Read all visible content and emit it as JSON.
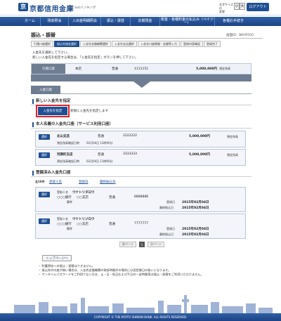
{
  "header": {
    "logo_mark": "京",
    "bank_name": "京都信用金庫",
    "service_name": "京信 hotバンキング",
    "font_size_label": "文字サイズの\n変更",
    "font_small": "小",
    "font_large": "大",
    "logout_label": "ログアウト"
  },
  "gnav": [
    "ホーム",
    "残高照会",
    "入出金明細照会",
    "振込・振替",
    "定期預金",
    "税金・各種料金の払込み（ペイジー）",
    "各種お手続き"
  ],
  "page": {
    "title": "振込・振替",
    "screen_id": "画面ID：BKHF050"
  },
  "steps": [
    {
      "label": "引落口座選択",
      "active": false
    },
    {
      "label": "振込先指定選択",
      "active": true
    },
    {
      "label": "入金先金融機関選択",
      "active": false
    },
    {
      "label": "入金先支店選択",
      "active": false
    },
    {
      "label": "入金先口座情報・金額等入力",
      "active": false
    },
    {
      "label": "登録内容確認",
      "active": false
    },
    {
      "label": "登録完了",
      "active": false
    }
  ],
  "instructions": [
    "入金先を選択して下さい。",
    "新しい入金先を指定する場合は、「入金先を指定」ボタンを押して下さい。"
  ],
  "withdrawal": {
    "label": "引落口座",
    "branch": "本店",
    "type": "普通",
    "number": "1111151",
    "balance": "5,000,000円",
    "balance_label": "預金残高"
  },
  "deposit_label": "入金口座",
  "new_section": {
    "title": "新しい入金先を指定",
    "button": "入金先を指定",
    "desc": "新規に入金先を指定します"
  },
  "own_section": {
    "title": "本人名義の入金先口座（サービス利用口座）",
    "accounts": [
      {
        "select": "選択",
        "branch": "北山支店",
        "type": "普通",
        "number": "2222222",
        "balance": "5,000,000円",
        "balance_label": "預金残高",
        "limit_label": "預金残高確認日時",
        "limit_value": "02月04日 11時00分"
      },
      {
        "select": "選択",
        "branch": "河原町支店",
        "type": "普通",
        "number": "3333333",
        "balance": "5,000,000円",
        "balance_label": "預金残高",
        "limit_label": "預金残高確認日時",
        "limit_value": "02月04日 11時00分"
      }
    ]
  },
  "registered_section": {
    "title": "登録済み入金先口座",
    "sort_all": "全10件",
    "sort_options": [
      "受取人名",
      "登録日",
      "最終振込日"
    ],
    "entries": [
      {
        "select": "選択",
        "recipient_label": "受取人名",
        "recipient": "ウケトリタロウ",
        "bank": "○○○銀行",
        "branch": "○○支店",
        "type": "普通",
        "number": "8888888",
        "memo_label": "備考",
        "reg_label": "登録日",
        "reg_date": "2015年02月04日",
        "last_label": "最終振込日",
        "last_date": "2015年02月04日"
      },
      {
        "select": "選択",
        "recipient_label": "受取人名",
        "recipient": "ウケトリジロウ",
        "bank": "○○○銀行",
        "branch": "○○支店",
        "type": "普通",
        "number": "7777777",
        "memo_label": "備考",
        "reg_label": "登録日",
        "reg_date": "2015年02月04日",
        "last_label": "最終振込日",
        "last_date": "2015年02月04日"
      }
    ]
  },
  "pager": {
    "prev": "前ページ",
    "current": "1",
    "next": "次ページ"
  },
  "top_button": "トップページへ",
  "notes": [
    "・ 貯蓄預金への振込・振替はできません。",
    "・ 振込先の口座が無い場合は、入金先金融機関の取扱時間外の場合には翌営業日の扱いとなります。",
    "・ ワンタイムパスワードをご利用でない方は、土・日・祝日および平日の一部時間帯は振込・振替をご利用いただけません。"
  ],
  "footer": {
    "copyright": "COPYRIGHT © THE KYOTO SHINKIN BANK. ALL RIGHTS RESERVED."
  },
  "colors": {
    "brand": "#1f4f93",
    "bar": "#6f7d92",
    "highlight": "#e0202a"
  }
}
